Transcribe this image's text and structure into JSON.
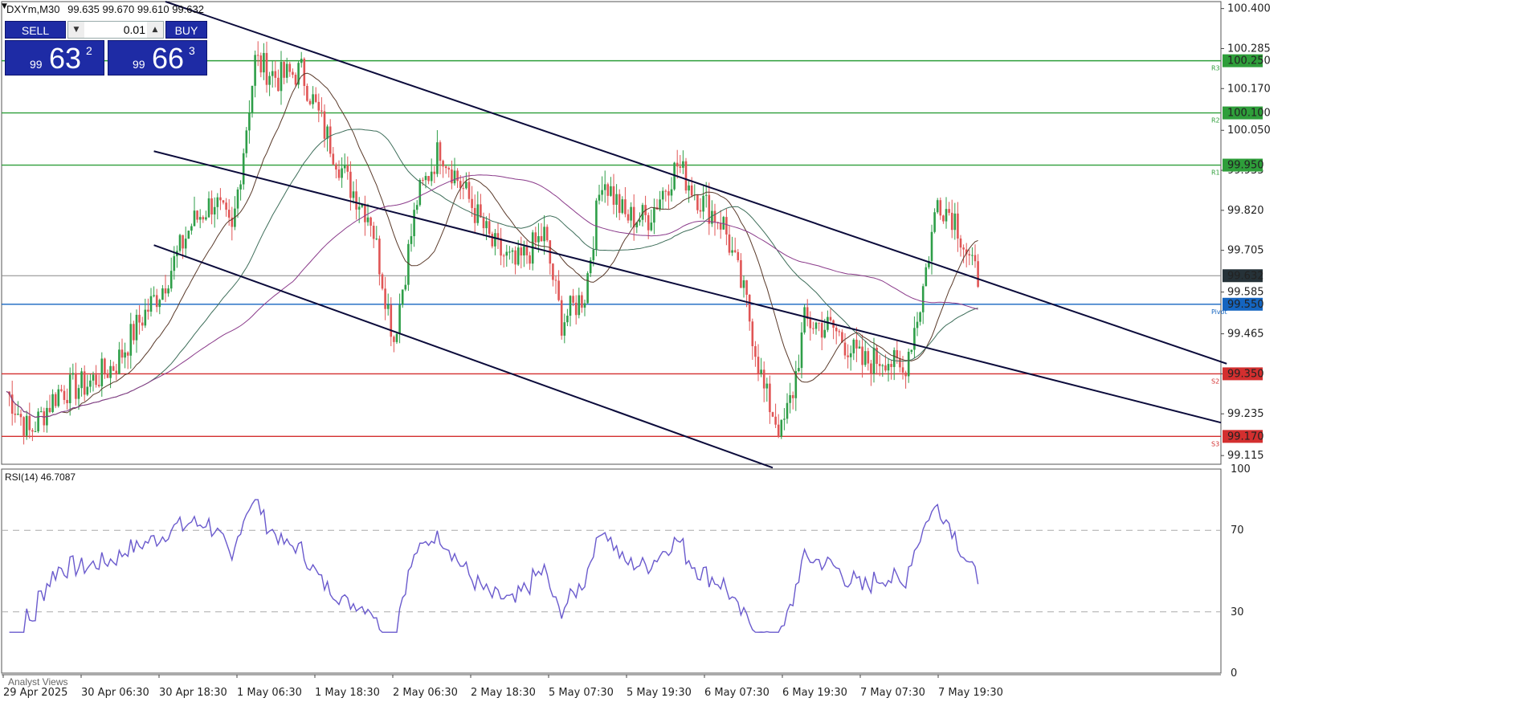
{
  "header": {
    "symbol_label": "DXYm,M30",
    "ohlc": "99.635 99.670 99.610 99.632"
  },
  "trade_panel": {
    "sell_label": "SELL",
    "buy_label": "BUY",
    "lot": "0.01",
    "sell_prefix": "99",
    "sell_big": "63",
    "sell_sup": "2",
    "buy_prefix": "99",
    "buy_big": "66",
    "buy_sup": "3"
  },
  "rsi_label": "RSI(14) 46.7087",
  "bottom_panel_label": "Analyst Views",
  "chart_data": [
    {
      "type": "candlestick",
      "title": "DXYm,M30",
      "ylim": [
        99.09,
        100.42
      ],
      "y_ticks": [
        "100.400",
        "100.285",
        "100.170",
        "100.050",
        "99.935",
        "99.820",
        "99.705",
        "99.585",
        "99.465",
        "99.350",
        "99.235",
        "99.115"
      ],
      "x_tick_labels": [
        "29 Apr 2025",
        "30 Apr 06:30",
        "30 Apr 18:30",
        "1 May 06:30",
        "1 May 18:30",
        "2 May 06:30",
        "2 May 18:30",
        "5 May 07:30",
        "5 May 19:30",
        "6 May 07:30",
        "6 May 19:30",
        "7 May 07:30",
        "7 May 19:30"
      ],
      "current_price": "99.632",
      "horizontal_levels": [
        {
          "label": "100.250",
          "value": 100.25,
          "color": "#2e9e3a",
          "tag": "R3"
        },
        {
          "label": "100.100",
          "value": 100.1,
          "color": "#2e9e3a",
          "tag": "R2"
        },
        {
          "label": "99.950",
          "value": 99.95,
          "color": "#2e9e3a",
          "tag": "R1"
        },
        {
          "label": "99.550",
          "value": 99.55,
          "color": "#1565c0",
          "tag": "Pivot"
        },
        {
          "label": "99.350",
          "value": 99.35,
          "color": "#d32f2f",
          "tag": "S2"
        },
        {
          "label": "99.170",
          "value": 99.17,
          "color": "#d32f2f",
          "tag": "S3"
        }
      ],
      "anchors": [
        [
          0,
          99.3
        ],
        [
          8,
          99.18
        ],
        [
          18,
          99.3
        ],
        [
          28,
          99.32
        ],
        [
          38,
          99.38
        ],
        [
          46,
          99.5
        ],
        [
          54,
          99.6
        ],
        [
          64,
          99.78
        ],
        [
          72,
          99.85
        ],
        [
          78,
          99.75
        ],
        [
          86,
          100.25
        ],
        [
          94,
          100.2
        ],
        [
          102,
          100.22
        ],
        [
          110,
          100.05
        ],
        [
          118,
          99.9
        ],
        [
          126,
          99.8
        ],
        [
          134,
          99.45
        ],
        [
          142,
          99.85
        ],
        [
          150,
          100.0
        ],
        [
          160,
          99.85
        ],
        [
          168,
          99.72
        ],
        [
          176,
          99.66
        ],
        [
          186,
          99.75
        ],
        [
          192,
          99.5
        ],
        [
          200,
          99.58
        ],
        [
          206,
          99.92
        ],
        [
          214,
          99.8
        ],
        [
          222,
          99.8
        ],
        [
          232,
          99.95
        ],
        [
          240,
          99.85
        ],
        [
          248,
          99.78
        ],
        [
          256,
          99.55
        ],
        [
          262,
          99.3
        ],
        [
          268,
          99.18
        ],
        [
          272,
          99.3
        ],
        [
          276,
          99.5
        ],
        [
          286,
          99.48
        ],
        [
          296,
          99.38
        ],
        [
          304,
          99.4
        ],
        [
          310,
          99.35
        ],
        [
          316,
          99.55
        ],
        [
          322,
          99.85
        ],
        [
          328,
          99.8
        ],
        [
          334,
          99.65
        ],
        [
          336,
          99.63
        ]
      ]
    },
    {
      "type": "line",
      "title": "RSI(14)",
      "ylim": [
        0,
        100
      ],
      "y_ticks": [
        "100",
        "70",
        "30",
        "0"
      ],
      "levels": [
        70,
        30
      ]
    }
  ]
}
